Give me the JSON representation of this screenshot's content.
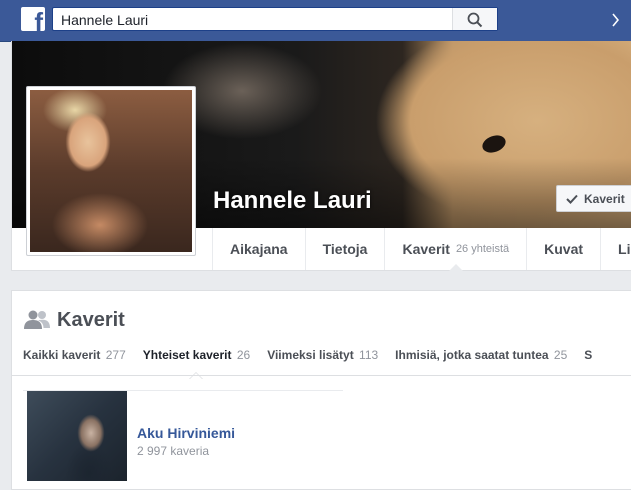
{
  "topbar": {
    "logo_letter": "f",
    "search_value": "Hannele Lauri"
  },
  "profile": {
    "name": "Hannele Lauri",
    "friend_button_label": "Kaverit"
  },
  "nav": [
    {
      "label": "Aikajana",
      "count": ""
    },
    {
      "label": "Tietoja",
      "count": ""
    },
    {
      "label": "Kaverit",
      "count": "26 yhteistä"
    },
    {
      "label": "Kuvat",
      "count": ""
    },
    {
      "label": "Li",
      "count": ""
    }
  ],
  "friends": {
    "title": "Kaverit",
    "filters": [
      {
        "label": "Kaikki kaverit",
        "count": "277"
      },
      {
        "label": "Yhteiset kaverit",
        "count": "26"
      },
      {
        "label": "Viimeksi lisätyt",
        "count": "113"
      },
      {
        "label": "Ihmisiä, jotka saatat tuntea",
        "count": "25"
      },
      {
        "label": "S",
        "count": ""
      }
    ],
    "items": [
      {
        "name": "Aku Hirviniemi",
        "sub": "2 997 kaveria"
      }
    ]
  },
  "colors": {
    "brand": "#3b5998",
    "link": "#365899",
    "muted": "#90949c"
  },
  "icons": [
    "facebook-logo-icon",
    "search-icon",
    "check-icon",
    "caret-down-icon",
    "friends-icon"
  ]
}
